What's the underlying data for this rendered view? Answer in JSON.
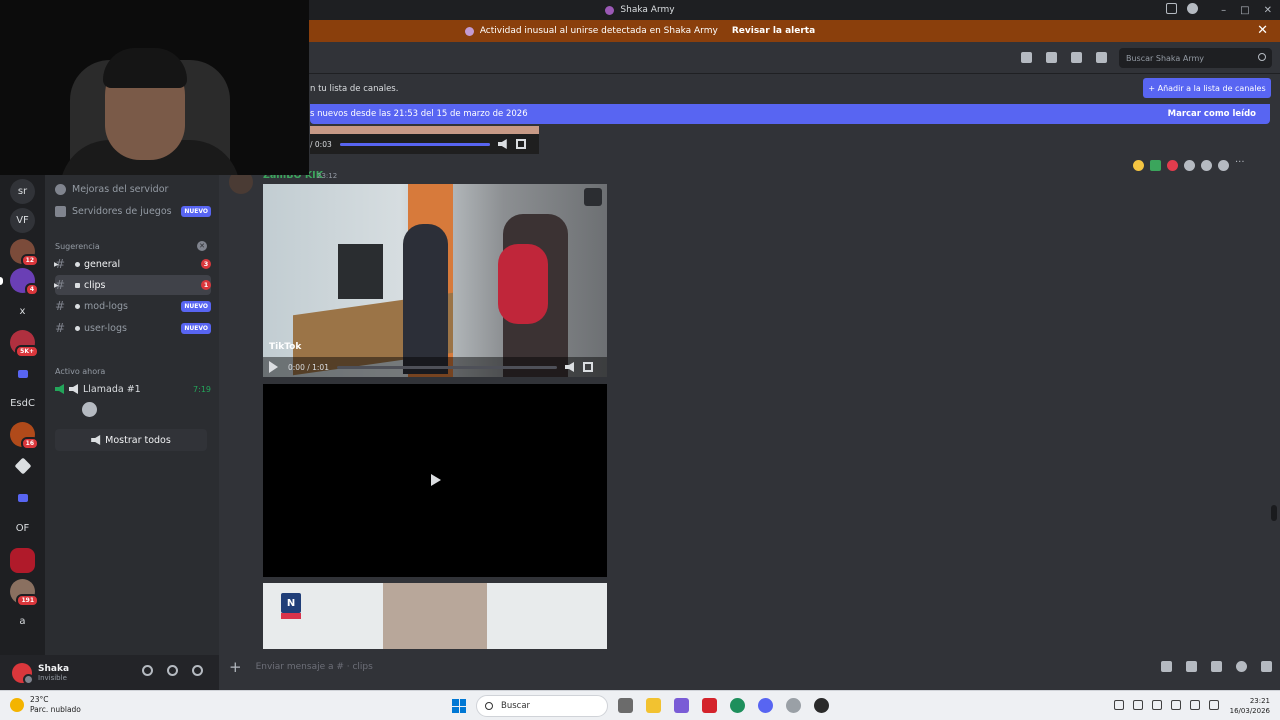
{
  "window": {
    "title": "Shaka Army"
  },
  "alert": {
    "text": "Actividad inusual al unirse detectada en Shaka Army",
    "action": "Revisar la alerta",
    "close": "✕"
  },
  "servers": [
    {
      "label": "sr"
    },
    {
      "label": "VF"
    },
    {
      "label": "",
      "badge": "12"
    },
    {
      "label": "",
      "badge": "4"
    },
    {
      "label": "x"
    },
    {
      "label": "",
      "badge": "5K+"
    },
    {
      "label": ""
    },
    {
      "label": "EsdC"
    },
    {
      "label": "",
      "badge": "16"
    },
    {
      "label": ""
    },
    {
      "label": ""
    },
    {
      "label": "OF"
    },
    {
      "label": ""
    },
    {
      "label": "",
      "badge": "191"
    },
    {
      "label": "a"
    }
  ],
  "sidebar": {
    "boost": "Mejoras del servidor",
    "game_servers": "Servidores de juegos",
    "game_servers_badge": "NUEVO",
    "suggestion_heading": "Sugerencia",
    "channels": [
      {
        "name": "general",
        "count": "3"
      },
      {
        "name": "clips",
        "count": "1"
      },
      {
        "name": "mod-logs",
        "badge": "NUEVO"
      },
      {
        "name": "user-logs",
        "badge": "NUEVO"
      }
    ],
    "active_heading": "Activo ahora",
    "voice": {
      "name": "Llamada #1",
      "time": "7:19"
    },
    "show_all": "Mostrar todos"
  },
  "user": {
    "name": "Shaka",
    "status": "Invisible"
  },
  "header": {
    "search_placeholder": "Buscar Shaka Army"
  },
  "banner": {
    "hint": "n tu lista de canales.",
    "add_button": "+ Añadir a la lista de canales",
    "new_messages": "s nuevos desde las 21:53 del 15 de marzo de 2026",
    "mark_read": "Marcar como leído"
  },
  "message": {
    "prev_video_time": "/ 0:03",
    "author": "ZamBO KIK",
    "time": "23:12",
    "video1": {
      "overlay": "TikTok",
      "time": "0:00 / 1:01",
      "progress": 0.0
    },
    "video3_logo": "N"
  },
  "composer": {
    "placeholder": "Enviar mensaje a # · clips"
  },
  "taskbar": {
    "temp": "23°C",
    "weather": "Parc. nublado",
    "search": "Buscar",
    "time": "23:21",
    "date": "16/03/2026"
  },
  "colors": {
    "accent": "#5865f2",
    "alert": "#8a3f0c",
    "online": "#23a55a",
    "badge": "#da373c"
  }
}
